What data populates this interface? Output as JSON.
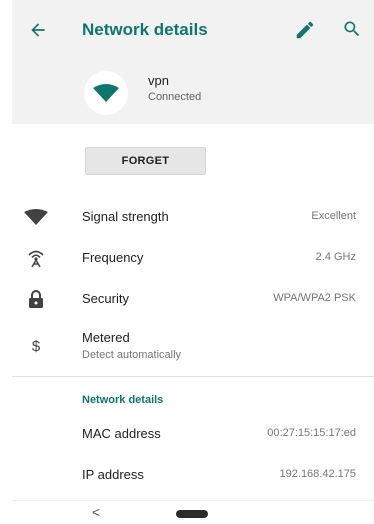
{
  "appbar": {
    "title": "Network details"
  },
  "network": {
    "ssid": "vpn",
    "status": "Connected"
  },
  "actions": {
    "forget_label": "FORGET"
  },
  "rows": {
    "signal": {
      "label": "Signal strength",
      "value": "Excellent"
    },
    "frequency": {
      "label": "Frequency",
      "value": "2.4 GHz"
    },
    "security": {
      "label": "Security",
      "value": "WPA/WPA2 PSK"
    },
    "metered": {
      "label": "Metered",
      "subtitle": "Detect automatically"
    }
  },
  "details_section": {
    "header": "Network details",
    "mac": {
      "label": "MAC address",
      "value": "00:27:15:15:17:ed"
    },
    "ip": {
      "label": "IP address",
      "value": "192.168.42.175"
    }
  },
  "navbar": {
    "back_glyph": "<"
  },
  "colors": {
    "accent": "#0f766e",
    "surface": "#f2f2f2"
  },
  "icons": [
    "back-arrow-icon",
    "edit-icon",
    "search-icon",
    "wifi-icon",
    "signal-icon",
    "frequency-icon",
    "lock-icon",
    "dollar-icon"
  ]
}
